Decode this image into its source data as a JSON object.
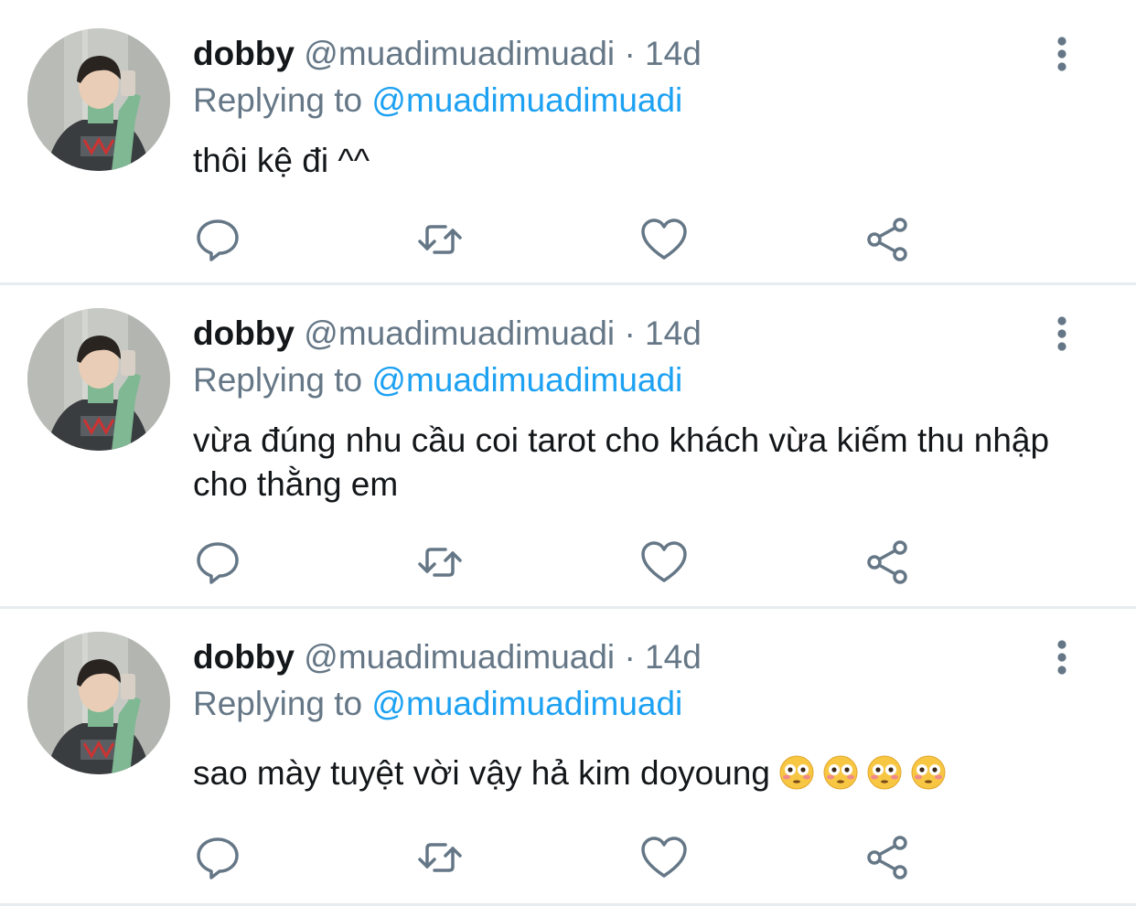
{
  "tweets": [
    {
      "name": "dobby",
      "handle": "@muadimuadimuadi",
      "separator": "·",
      "time": "14d",
      "replying_prefix": "Replying to",
      "replying_to": "@muadimuadimuadi",
      "text": "thôi kệ đi ^^"
    },
    {
      "name": "dobby",
      "handle": "@muadimuadimuadi",
      "separator": "·",
      "time": "14d",
      "replying_prefix": "Replying to",
      "replying_to": "@muadimuadimuadi",
      "text": "vừa đúng nhu cầu coi tarot cho khách vừa kiếm thu nhập cho thằng em"
    },
    {
      "name": "dobby",
      "handle": "@muadimuadimuadi",
      "separator": "·",
      "time": "14d",
      "replying_prefix": "Replying to",
      "replying_to": "@muadimuadimuadi",
      "text": "sao mày tuyệt vời vậy hả kim doyoung",
      "emojis": [
        "flushed-face",
        "flushed-face",
        "flushed-face",
        "flushed-face"
      ]
    }
  ],
  "colors": {
    "text": "#14171a",
    "secondary": "#657786",
    "link": "#1da1f2",
    "border": "#e6ecf0"
  },
  "icons": [
    "reply-icon",
    "retweet-icon",
    "like-icon",
    "share-icon",
    "more-vertical-icon"
  ]
}
